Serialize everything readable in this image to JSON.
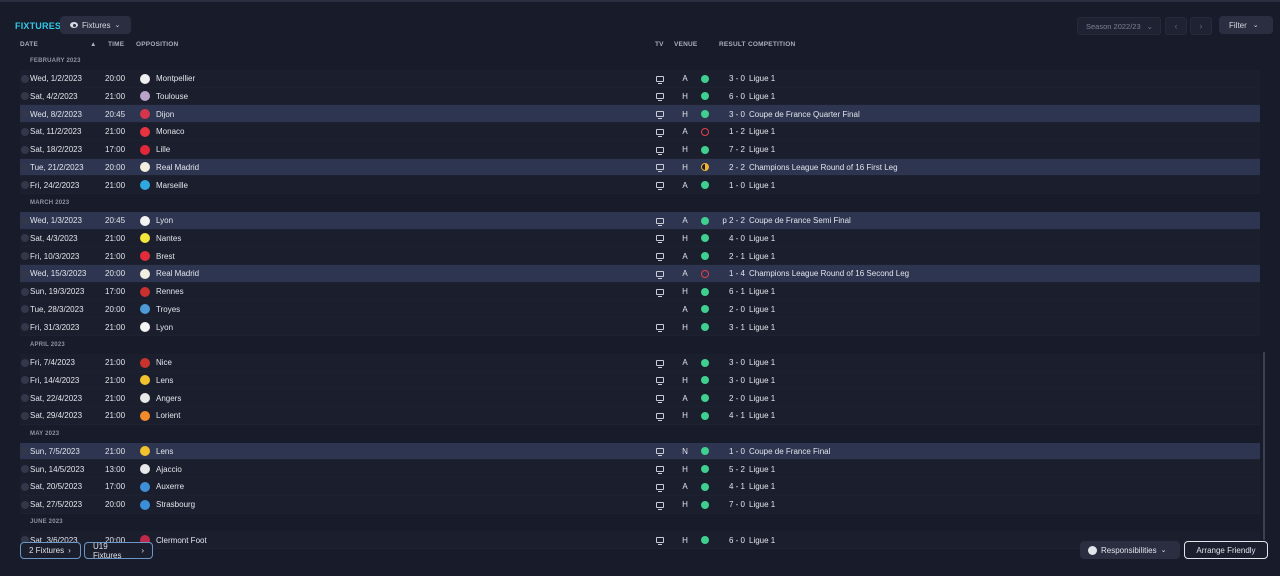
{
  "header": {
    "title": "FIXTURES",
    "view_label": "Fixtures",
    "season": "Season 2022/23",
    "filter_label": "Filter"
  },
  "columns": {
    "date": "DATE",
    "time": "TIME",
    "opposition": "OPPOSITION",
    "tv": "TV",
    "venue": "VENUE",
    "result": "RESULT",
    "competition": "COMPETITION"
  },
  "groups": [
    {
      "label": "FEBRUARY 2023",
      "rows": [
        {
          "date": "Wed, 1/2/2023",
          "time": "20:00",
          "opp": "Montpellier",
          "venue": "A",
          "outcome": "win",
          "score": "3 - 0",
          "comp": "Ligue 1",
          "tv": true,
          "highlight": false,
          "color": "#f0f0f0"
        },
        {
          "date": "Sat, 4/2/2023",
          "time": "21:00",
          "opp": "Toulouse",
          "venue": "H",
          "outcome": "win",
          "score": "6 - 0",
          "comp": "Ligue 1",
          "tv": true,
          "highlight": false,
          "color": "#b9a3c9"
        },
        {
          "date": "Wed, 8/2/2023",
          "time": "20:45",
          "opp": "Dijon",
          "venue": "H",
          "outcome": "win",
          "score": "3 - 0",
          "comp": "Coupe de France Quarter Final",
          "tv": true,
          "highlight": true,
          "color": "#d6364b"
        },
        {
          "date": "Sat, 11/2/2023",
          "time": "21:00",
          "opp": "Monaco",
          "venue": "A",
          "outcome": "loss",
          "score": "1 - 2",
          "comp": "Ligue 1",
          "tv": true,
          "highlight": false,
          "color": "#e5333f"
        },
        {
          "date": "Sat, 18/2/2023",
          "time": "17:00",
          "opp": "Lille",
          "venue": "H",
          "outcome": "win",
          "score": "7 - 2",
          "comp": "Ligue 1",
          "tv": true,
          "highlight": false,
          "color": "#e3273a"
        },
        {
          "date": "Tue, 21/2/2023",
          "time": "20:00",
          "opp": "Real Madrid",
          "venue": "H",
          "outcome": "draw",
          "score": "2 - 2",
          "comp": "Champions League Round of 16  First Leg",
          "tv": true,
          "highlight": true,
          "color": "#f3efe0"
        },
        {
          "date": "Fri, 24/2/2023",
          "time": "21:00",
          "opp": "Marseille",
          "venue": "A",
          "outcome": "win",
          "score": "1 - 0",
          "comp": "Ligue 1",
          "tv": true,
          "highlight": false,
          "color": "#2fa7df"
        }
      ]
    },
    {
      "label": "MARCH 2023",
      "rows": [
        {
          "date": "Wed, 1/3/2023",
          "time": "20:45",
          "opp": "Lyon",
          "venue": "A",
          "outcome": "win",
          "score": "p 2 - 2",
          "comp": "Coupe de France Semi Final",
          "tv": true,
          "highlight": true,
          "color": "#f4f4f4"
        },
        {
          "date": "Sat, 4/3/2023",
          "time": "21:00",
          "opp": "Nantes",
          "venue": "H",
          "outcome": "win",
          "score": "4 - 0",
          "comp": "Ligue 1",
          "tv": true,
          "highlight": false,
          "color": "#f2e63a"
        },
        {
          "date": "Fri, 10/3/2023",
          "time": "21:00",
          "opp": "Brest",
          "venue": "A",
          "outcome": "win",
          "score": "2 - 1",
          "comp": "Ligue 1",
          "tv": true,
          "highlight": false,
          "color": "#e12c3a"
        },
        {
          "date": "Wed, 15/3/2023",
          "time": "20:00",
          "opp": "Real Madrid",
          "venue": "A",
          "outcome": "loss",
          "score": "1 - 4",
          "comp": "Champions League Round of 16  Second Leg",
          "tv": true,
          "highlight": true,
          "color": "#f3efe0"
        },
        {
          "date": "Sun, 19/3/2023",
          "time": "17:00",
          "opp": "Rennes",
          "venue": "H",
          "outcome": "win",
          "score": "6 - 1",
          "comp": "Ligue 1",
          "tv": true,
          "highlight": false,
          "color": "#c9312e"
        },
        {
          "date": "Tue, 28/3/2023",
          "time": "20:00",
          "opp": "Troyes",
          "venue": "A",
          "outcome": "win",
          "score": "2 - 0",
          "comp": "Ligue 1",
          "tv": false,
          "highlight": false,
          "color": "#4d9ad8"
        },
        {
          "date": "Fri, 31/3/2023",
          "time": "21:00",
          "opp": "Lyon",
          "venue": "H",
          "outcome": "win",
          "score": "3 - 1",
          "comp": "Ligue 1",
          "tv": true,
          "highlight": false,
          "color": "#f4f4f4"
        }
      ]
    },
    {
      "label": "APRIL 2023",
      "rows": [
        {
          "date": "Fri, 7/4/2023",
          "time": "21:00",
          "opp": "Nice",
          "venue": "A",
          "outcome": "win",
          "score": "3 - 0",
          "comp": "Ligue 1",
          "tv": true,
          "highlight": false,
          "color": "#c8332c"
        },
        {
          "date": "Fri, 14/4/2023",
          "time": "21:00",
          "opp": "Lens",
          "venue": "H",
          "outcome": "win",
          "score": "3 - 0",
          "comp": "Ligue 1",
          "tv": true,
          "highlight": false,
          "color": "#f2c12e"
        },
        {
          "date": "Sat, 22/4/2023",
          "time": "21:00",
          "opp": "Angers",
          "venue": "A",
          "outcome": "win",
          "score": "2 - 0",
          "comp": "Ligue 1",
          "tv": true,
          "highlight": false,
          "color": "#e8e8e8"
        },
        {
          "date": "Sat, 29/4/2023",
          "time": "21:00",
          "opp": "Lorient",
          "venue": "H",
          "outcome": "win",
          "score": "4 - 1",
          "comp": "Ligue 1",
          "tv": true,
          "highlight": false,
          "color": "#f28c2b"
        }
      ]
    },
    {
      "label": "MAY 2023",
      "rows": [
        {
          "date": "Sun, 7/5/2023",
          "time": "21:00",
          "opp": "Lens",
          "venue": "N",
          "outcome": "win",
          "score": "1 - 0",
          "comp": "Coupe de France Final",
          "tv": true,
          "highlight": true,
          "color": "#f2c12e"
        },
        {
          "date": "Sun, 14/5/2023",
          "time": "13:00",
          "opp": "Ajaccio",
          "venue": "H",
          "outcome": "win",
          "score": "5 - 2",
          "comp": "Ligue 1",
          "tv": true,
          "highlight": false,
          "color": "#e9e9e9"
        },
        {
          "date": "Sat, 20/5/2023",
          "time": "17:00",
          "opp": "Auxerre",
          "venue": "A",
          "outcome": "win",
          "score": "4 - 1",
          "comp": "Ligue 1",
          "tv": true,
          "highlight": false,
          "color": "#3f8fd8"
        },
        {
          "date": "Sat, 27/5/2023",
          "time": "20:00",
          "opp": "Strasbourg",
          "venue": "H",
          "outcome": "win",
          "score": "7 - 0",
          "comp": "Ligue 1",
          "tv": true,
          "highlight": false,
          "color": "#3b8fd6"
        }
      ]
    },
    {
      "label": "JUNE 2023",
      "rows": [
        {
          "date": "Sat, 3/6/2023",
          "time": "20:00",
          "opp": "Clermont Foot",
          "venue": "H",
          "outcome": "win",
          "score": "6 - 0",
          "comp": "Ligue 1",
          "tv": true,
          "highlight": false,
          "color": "#c02a4a"
        }
      ]
    }
  ],
  "footer": {
    "fixtures_btn": "2 Fixtures",
    "u19_btn": "U19 Fixtures",
    "responsibilities": "Responsibilities",
    "arrange": "Arrange Friendly"
  }
}
